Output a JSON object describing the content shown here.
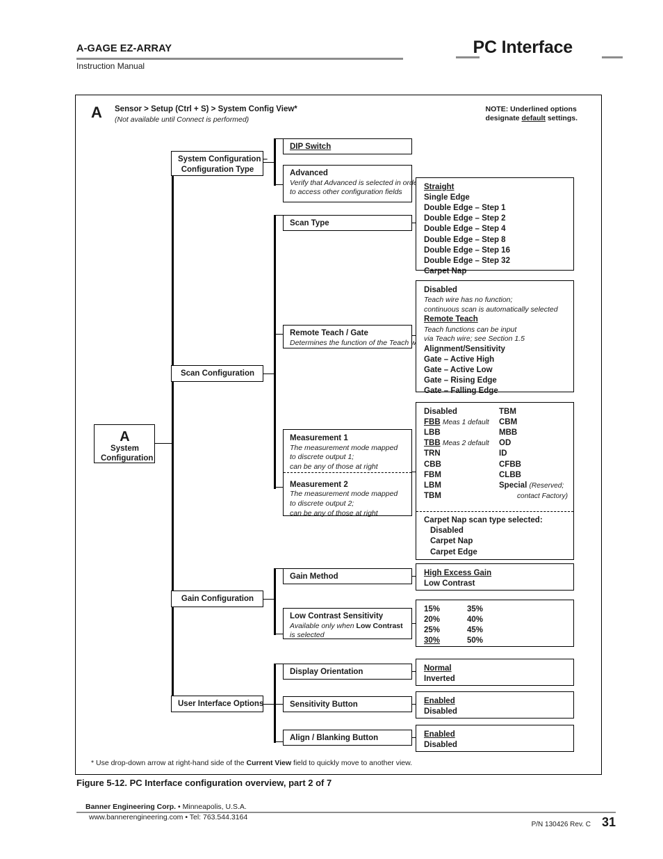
{
  "header": {
    "product_title": "A-GAGE EZ-ARRAY",
    "doc_type": "Instruction Manual",
    "section_title": "PC Interface"
  },
  "figure": {
    "annotation_letter": "A",
    "annotation_path": "Sensor > Setup (Ctrl + S) > System Config View*",
    "annotation_note": "(Not available until Connect is performed)",
    "note_default_line1": "NOTE: Underlined options",
    "note_default_line2_pre": "designate ",
    "note_default_line2_underline": "default",
    "note_default_line2_post": " settings.",
    "root": {
      "letter": "A",
      "label_line1": "System",
      "label_line2": "Configuration"
    },
    "branches": [
      {
        "name": "System Configuration – Configuration Type",
        "label_line1": "System Configuration –",
        "label_line2": "Configuration Type"
      },
      {
        "name": "Scan Configuration",
        "label_line1": "Scan Configuration",
        "label_line2": ""
      },
      {
        "name": "Gain Configuration",
        "label_line1": "Gain Configuration",
        "label_line2": ""
      },
      {
        "name": "User Interface Options",
        "label_line1": "User Interface Options",
        "label_line2": ""
      }
    ],
    "fields": {
      "dip_switch": {
        "title": "DIP Switch"
      },
      "advanced": {
        "title": "Advanced",
        "desc_line1": "Verify that Advanced is selected in order",
        "desc_line2": " to access other configuration fields"
      },
      "scan_type": {
        "title": "Scan Type"
      },
      "remote_teach_gate": {
        "title": "Remote Teach / Gate",
        "desc_line1": "Determines the function of the Teach wire"
      },
      "measurement1": {
        "title": "Measurement 1",
        "desc_line1": "The measurement mode mapped",
        "desc_line2": "to discrete output 1;",
        "desc_line3": "can be any of those at right"
      },
      "measurement2": {
        "title": "Measurement 2",
        "desc_line1": "The measurement mode mapped",
        "desc_line2": "to discrete output 2;",
        "desc_line3": "can be any of those at right"
      },
      "gain_method": {
        "title": "Gain Method"
      },
      "low_contrast_sensitivity": {
        "title": "Low Contrast Sensitivity",
        "desc_line1_pre": "Available only when ",
        "desc_line1_bold": "Low Contrast",
        "desc_line2": "is selected"
      },
      "display_orientation": {
        "title": "Display Orientation"
      },
      "sensitivity_button": {
        "title": "Sensitivity Button"
      },
      "align_blanking_button": {
        "title": "Align / Blanking Button"
      }
    },
    "options": {
      "scan_type": [
        {
          "label": "Straight",
          "default": true
        },
        {
          "label": "Single Edge",
          "default": false
        },
        {
          "label": "Double Edge – Step 1",
          "default": false
        },
        {
          "label": "Double Edge – Step 2",
          "default": false
        },
        {
          "label": "Double Edge – Step 4",
          "default": false
        },
        {
          "label": "Double Edge – Step 8",
          "default": false
        },
        {
          "label": "Double Edge – Step 16",
          "default": false
        },
        {
          "label": "Double Edge – Step 32",
          "default": false
        },
        {
          "label": "Carpet Nap",
          "default": false
        }
      ],
      "remote_teach_gate": [
        {
          "label": "Disabled",
          "default": false,
          "desc": [
            "Teach wire has no function;",
            "continuous scan is automatically selected"
          ]
        },
        {
          "label": "Remote Teach",
          "default": true,
          "desc": [
            "Teach functions can be input",
            "via Teach wire; see Section 1.5"
          ]
        },
        {
          "label": "Alignment/Sensitivity",
          "default": false,
          "desc": []
        },
        {
          "label": "Gate – Active High",
          "default": false,
          "desc": []
        },
        {
          "label": "Gate – Active Low",
          "default": false,
          "desc": []
        },
        {
          "label": "Gate – Rising Edge",
          "default": false,
          "desc": []
        },
        {
          "label": "Gate – Falling Edge",
          "default": false,
          "desc": []
        }
      ],
      "measurement_col1": [
        {
          "label": "Disabled",
          "default": false,
          "note": ""
        },
        {
          "label": "FBB",
          "default": true,
          "note": "Meas 1 default"
        },
        {
          "label": "LBB",
          "default": false,
          "note": ""
        },
        {
          "label": "TBB",
          "default": true,
          "note": "Meas 2 default"
        },
        {
          "label": "TRN",
          "default": false,
          "note": ""
        },
        {
          "label": "CBB",
          "default": false,
          "note": ""
        },
        {
          "label": "FBM",
          "default": false,
          "note": ""
        },
        {
          "label": "LBM",
          "default": false,
          "note": ""
        },
        {
          "label": "TBM",
          "default": false,
          "note": ""
        }
      ],
      "measurement_col2": [
        {
          "label": "TBM",
          "default": false,
          "note": ""
        },
        {
          "label": "CBM",
          "default": false,
          "note": ""
        },
        {
          "label": "MBB",
          "default": false,
          "note": ""
        },
        {
          "label": "OD",
          "default": false,
          "note": ""
        },
        {
          "label": "ID",
          "default": false,
          "note": ""
        },
        {
          "label": "CFBB",
          "default": false,
          "note": ""
        },
        {
          "label": "CLBB",
          "default": false,
          "note": ""
        },
        {
          "label": "Special",
          "default": false,
          "note": "(Reserved;"
        },
        {
          "label": "",
          "default": false,
          "note": "contact Factory)"
        }
      ],
      "carpet_nap": {
        "title": "Carpet Nap scan type selected:",
        "items": [
          "Disabled",
          "Carpet Nap",
          "Carpet Edge"
        ]
      },
      "gain_method": [
        {
          "label": "High Excess Gain",
          "default": true
        },
        {
          "label": "Low Contrast",
          "default": false
        }
      ],
      "low_contrast_col1": [
        {
          "label": "15%",
          "default": false
        },
        {
          "label": "20%",
          "default": false
        },
        {
          "label": "25%",
          "default": false
        },
        {
          "label": "30%",
          "default": true
        }
      ],
      "low_contrast_col2": [
        {
          "label": "35%",
          "default": false
        },
        {
          "label": "40%",
          "default": false
        },
        {
          "label": "45%",
          "default": false
        },
        {
          "label": "50%",
          "default": false
        }
      ],
      "display_orientation": [
        {
          "label": "Normal",
          "default": true
        },
        {
          "label": "Inverted",
          "default": false
        }
      ],
      "sensitivity_button": [
        {
          "label": "Enabled",
          "default": true
        },
        {
          "label": "Disabled",
          "default": false
        }
      ],
      "align_blanking_button": [
        {
          "label": "Enabled",
          "default": true
        },
        {
          "label": "Disabled",
          "default": false
        }
      ]
    },
    "footnote_pre": "* Use drop-down arrow at right-hand side of the ",
    "footnote_bold": "Current View",
    "footnote_post": " field to quickly move to another view.",
    "caption": "Figure 5-12.  PC Interface configuration overview, part 2 of 7"
  },
  "footer": {
    "company_bold": "Banner Engineering Corp.",
    "company_rest": " • Minneapolis, U.S.A.",
    "web": "www.bannerengineering.com  •  Tel: 763.544.3164",
    "part_number": "P/N 130426 Rev. C",
    "page_number": "31"
  }
}
